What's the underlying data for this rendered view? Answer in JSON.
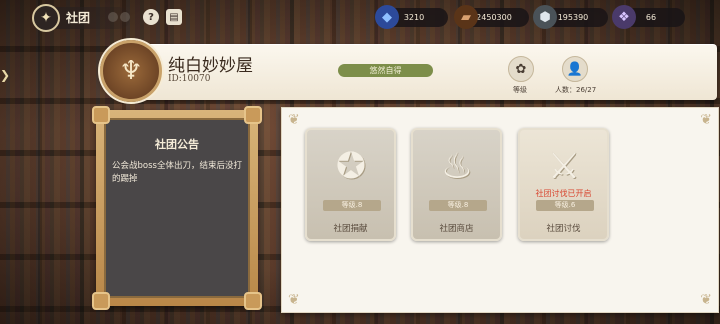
{
  "header": {
    "title": "社团",
    "help_icon": "?",
    "info_icon": "▤"
  },
  "resources": [
    {
      "name": "blue-gem",
      "value": "3210",
      "color": "#3a6fd8"
    },
    {
      "name": "chocolate",
      "value": "2450300",
      "color": "#7a4a2a"
    },
    {
      "name": "silver-ore",
      "value": "195390",
      "color": "#9aa4ac"
    },
    {
      "name": "crystal",
      "value": "66",
      "color": "#b89ae0"
    }
  ],
  "club": {
    "name": "纯白妙妙屋",
    "id": "ID:10070",
    "motto": "悠然自得",
    "level_label": "等级",
    "members_label": "人数：26/27"
  },
  "announcement": {
    "title": "社团公告",
    "text": "公会战boss全体出刀，结束后没打的踢掉"
  },
  "features": [
    {
      "name": "社团捐献",
      "level": "等级.8",
      "notice": "",
      "icon": "✪"
    },
    {
      "name": "社团商店",
      "level": "等级.8",
      "notice": "",
      "icon": "♨"
    },
    {
      "name": "社团讨伐",
      "level": "等级.6",
      "notice": "社团讨伐已开启",
      "icon": "⚔"
    }
  ],
  "colors": {
    "motto_bg": "#7d8e4a",
    "notice": "#d8452f",
    "board_frame": "#c99a5a"
  }
}
